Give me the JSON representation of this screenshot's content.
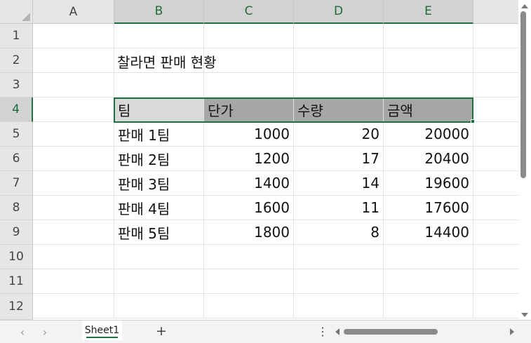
{
  "columns": [
    "A",
    "B",
    "C",
    "D",
    "E"
  ],
  "rows": [
    "1",
    "2",
    "3",
    "4",
    "5",
    "6",
    "7",
    "8",
    "9",
    "10",
    "11",
    "12"
  ],
  "title": "찰라면 판매 현황",
  "header": {
    "team": "팀",
    "price": "단가",
    "qty": "수량",
    "amount": "금액"
  },
  "data_rows": [
    {
      "team": "판매 1팀",
      "price": "1000",
      "qty": "20",
      "amount": "20000"
    },
    {
      "team": "판매 2팀",
      "price": "1200",
      "qty": "17",
      "amount": "20400"
    },
    {
      "team": "판매 3팀",
      "price": "1400",
      "qty": "14",
      "amount": "19600"
    },
    {
      "team": "판매 4팀",
      "price": "1600",
      "qty": "11",
      "amount": "17600"
    },
    {
      "team": "판매 5팀",
      "price": "1800",
      "qty": "8",
      "amount": "14400"
    }
  ],
  "sheet_tabs": [
    "Sheet1"
  ],
  "bottom": {
    "prev": "‹",
    "next": "›",
    "add": "+",
    "more": "⋮"
  },
  "colors": {
    "accent": "#1e7145",
    "header_fill": "#a6a6a6"
  }
}
